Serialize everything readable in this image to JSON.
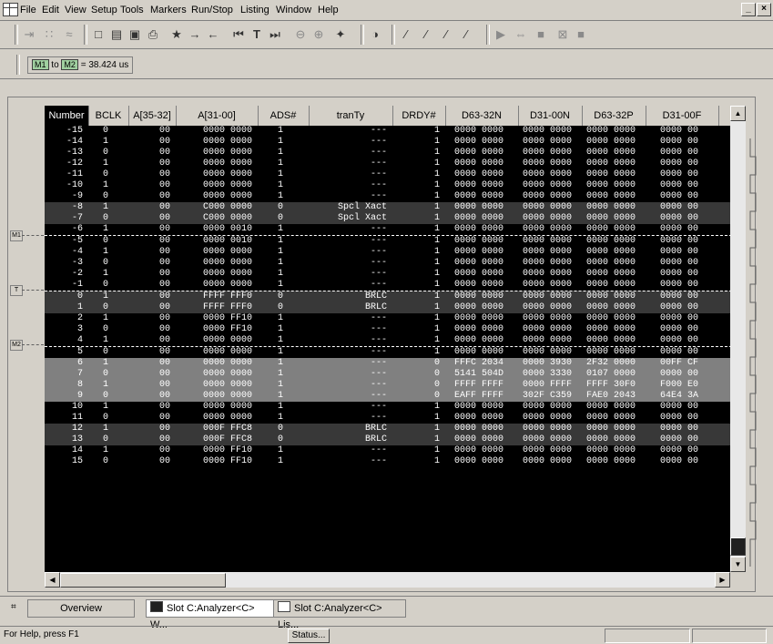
{
  "menu": [
    "File",
    "Edit",
    "View",
    "Setup",
    "Tools",
    "Markers",
    "Run/Stop",
    "Listing",
    "Window",
    "Help"
  ],
  "window_buttons": [
    "_",
    "×"
  ],
  "toolbar_icons": [
    {
      "name": "run-repetitive-icon",
      "glyph": "⇥"
    },
    {
      "name": "step-icon",
      "glyph": "∷"
    },
    {
      "name": "scope-icon",
      "glyph": "≈"
    },
    {
      "name": "new-icon",
      "glyph": "□"
    },
    {
      "name": "open-icon",
      "glyph": "▤"
    },
    {
      "name": "save-icon",
      "glyph": "▣"
    },
    {
      "name": "print-icon",
      "glyph": "⎙"
    },
    {
      "name": "find-icon",
      "glyph": "★"
    },
    {
      "name": "find-next-icon",
      "glyph": "→"
    },
    {
      "name": "find-prev-icon",
      "glyph": "←"
    },
    {
      "name": "go-start-icon",
      "glyph": "⏮"
    },
    {
      "name": "go-trigger-icon",
      "glyph": "T"
    },
    {
      "name": "go-end-icon",
      "glyph": "⏭"
    },
    {
      "name": "zoom-out-icon",
      "glyph": "⊖"
    },
    {
      "name": "zoom-in-icon",
      "glyph": "⊕"
    },
    {
      "name": "marker-icon",
      "glyph": "✦"
    },
    {
      "name": "compare-icon",
      "glyph": "◑"
    },
    {
      "name": "filter1-icon",
      "glyph": "⁄"
    },
    {
      "name": "filter2-icon",
      "glyph": "⁄"
    },
    {
      "name": "filter3-icon",
      "glyph": "⁄"
    },
    {
      "name": "filter4-icon",
      "glyph": "⁄"
    },
    {
      "name": "run-icon",
      "glyph": "▶"
    },
    {
      "name": "run-group-icon",
      "glyph": "⇔"
    },
    {
      "name": "stop-icon",
      "glyph": "■"
    },
    {
      "name": "cancel-icon",
      "glyph": "⊠"
    },
    {
      "name": "stop2-icon",
      "glyph": "■"
    }
  ],
  "marker_readout": {
    "m1": "M1",
    "to": " to ",
    "m2": "M2",
    "value": " = 38.424 us"
  },
  "columns": [
    "Number",
    "BCLK",
    "A[35-32]",
    "A[31-00]",
    "ADS#",
    "tranTy",
    "DRDY#",
    "D63-32N",
    "D31-00N",
    "D63-32P",
    "D31-00F"
  ],
  "rows": [
    {
      "n": "-15",
      "bclk": "0",
      "ah": "00",
      "al": "0000 0000",
      "ads": "1",
      "tt": "---",
      "drdy": "1",
      "d1": "0000 0000",
      "d2": "0000 0000",
      "d3": "0000 0000",
      "d4": "0000 00",
      "style": ""
    },
    {
      "n": "-14",
      "bclk": "1",
      "ah": "00",
      "al": "0000 0000",
      "ads": "1",
      "tt": "---",
      "drdy": "1",
      "d1": "0000 0000",
      "d2": "0000 0000",
      "d3": "0000 0000",
      "d4": "0000 00",
      "style": ""
    },
    {
      "n": "-13",
      "bclk": "0",
      "ah": "00",
      "al": "0000 0000",
      "ads": "1",
      "tt": "---",
      "drdy": "1",
      "d1": "0000 0000",
      "d2": "0000 0000",
      "d3": "0000 0000",
      "d4": "0000 00",
      "style": ""
    },
    {
      "n": "-12",
      "bclk": "1",
      "ah": "00",
      "al": "0000 0000",
      "ads": "1",
      "tt": "---",
      "drdy": "1",
      "d1": "0000 0000",
      "d2": "0000 0000",
      "d3": "0000 0000",
      "d4": "0000 00",
      "style": ""
    },
    {
      "n": "-11",
      "bclk": "0",
      "ah": "00",
      "al": "0000 0000",
      "ads": "1",
      "tt": "---",
      "drdy": "1",
      "d1": "0000 0000",
      "d2": "0000 0000",
      "d3": "0000 0000",
      "d4": "0000 00",
      "style": ""
    },
    {
      "n": "-10",
      "bclk": "1",
      "ah": "00",
      "al": "0000 0000",
      "ads": "1",
      "tt": "---",
      "drdy": "1",
      "d1": "0000 0000",
      "d2": "0000 0000",
      "d3": "0000 0000",
      "d4": "0000 00",
      "style": ""
    },
    {
      "n": "-9",
      "bclk": "0",
      "ah": "00",
      "al": "0000 0000",
      "ads": "1",
      "tt": "---",
      "drdy": "1",
      "d1": "0000 0000",
      "d2": "0000 0000",
      "d3": "0000 0000",
      "d4": "0000 00",
      "style": ""
    },
    {
      "n": "-8",
      "bclk": "1",
      "ah": "00",
      "al": "C000 0000",
      "ads": "0",
      "tt": "Spcl Xact",
      "drdy": "1",
      "d1": "0000 0000",
      "d2": "0000 0000",
      "d3": "0000 0000",
      "d4": "0000 00",
      "style": "dark"
    },
    {
      "n": "-7",
      "bclk": "0",
      "ah": "00",
      "al": "C000 0000",
      "ads": "0",
      "tt": "Spcl Xact",
      "drdy": "1",
      "d1": "0000 0000",
      "d2": "0000 0000",
      "d3": "0000 0000",
      "d4": "0000 00",
      "style": "dark"
    },
    {
      "n": "-6",
      "bclk": "1",
      "ah": "00",
      "al": "0000 0010",
      "ads": "1",
      "tt": "---",
      "drdy": "1",
      "d1": "0000 0000",
      "d2": "0000 0000",
      "d3": "0000 0000",
      "d4": "0000 00",
      "style": ""
    },
    {
      "n": "-5",
      "bclk": "0",
      "ah": "00",
      "al": "0000 0010",
      "ads": "1",
      "tt": "---",
      "drdy": "1",
      "d1": "0000 0000",
      "d2": "0000 0000",
      "d3": "0000 0000",
      "d4": "0000 00",
      "style": "marker"
    },
    {
      "n": "-4",
      "bclk": "1",
      "ah": "00",
      "al": "0000 0000",
      "ads": "1",
      "tt": "---",
      "drdy": "1",
      "d1": "0000 0000",
      "d2": "0000 0000",
      "d3": "0000 0000",
      "d4": "0000 00",
      "style": ""
    },
    {
      "n": "-3",
      "bclk": "0",
      "ah": "00",
      "al": "0000 0000",
      "ads": "1",
      "tt": "---",
      "drdy": "1",
      "d1": "0000 0000",
      "d2": "0000 0000",
      "d3": "0000 0000",
      "d4": "0000 00",
      "style": ""
    },
    {
      "n": "-2",
      "bclk": "1",
      "ah": "00",
      "al": "0000 0000",
      "ads": "1",
      "tt": "---",
      "drdy": "1",
      "d1": "0000 0000",
      "d2": "0000 0000",
      "d3": "0000 0000",
      "d4": "0000 00",
      "style": ""
    },
    {
      "n": "-1",
      "bclk": "0",
      "ah": "00",
      "al": "0000 0000",
      "ads": "1",
      "tt": "---",
      "drdy": "1",
      "d1": "0000 0000",
      "d2": "0000 0000",
      "d3": "0000 0000",
      "d4": "0000 00",
      "style": ""
    },
    {
      "n": "0",
      "bclk": "1",
      "ah": "00",
      "al": "FFFF FFF0",
      "ads": "0",
      "tt": "BRLC",
      "drdy": "1",
      "d1": "0000 0000",
      "d2": "0000 0000",
      "d3": "0000 0000",
      "d4": "0000 00",
      "style": "dark marker"
    },
    {
      "n": "1",
      "bclk": "0",
      "ah": "00",
      "al": "FFFF FFF0",
      "ads": "0",
      "tt": "BRLC",
      "drdy": "1",
      "d1": "0000 0000",
      "d2": "0000 0000",
      "d3": "0000 0000",
      "d4": "0000 00",
      "style": "dark"
    },
    {
      "n": "2",
      "bclk": "1",
      "ah": "00",
      "al": "0000 FF10",
      "ads": "1",
      "tt": "---",
      "drdy": "1",
      "d1": "0000 0000",
      "d2": "0000 0000",
      "d3": "0000 0000",
      "d4": "0000 00",
      "style": ""
    },
    {
      "n": "3",
      "bclk": "0",
      "ah": "00",
      "al": "0000 FF10",
      "ads": "1",
      "tt": "---",
      "drdy": "1",
      "d1": "0000 0000",
      "d2": "0000 0000",
      "d3": "0000 0000",
      "d4": "0000 00",
      "style": ""
    },
    {
      "n": "4",
      "bclk": "1",
      "ah": "00",
      "al": "0000 0000",
      "ads": "1",
      "tt": "---",
      "drdy": "1",
      "d1": "0000 0000",
      "d2": "0000 0000",
      "d3": "0000 0000",
      "d4": "0000 00",
      "style": ""
    },
    {
      "n": "5",
      "bclk": "0",
      "ah": "00",
      "al": "0000 0000",
      "ads": "1",
      "tt": "---",
      "drdy": "1",
      "d1": "0000 0000",
      "d2": "0000 0000",
      "d3": "0000 0000",
      "d4": "0000 00",
      "style": "marker"
    },
    {
      "n": "6",
      "bclk": "1",
      "ah": "00",
      "al": "0000 0000",
      "ads": "1",
      "tt": "---",
      "drdy": "0",
      "d1": "FFFC 2034",
      "d2": "0000 3930",
      "d3": "2F32 0000",
      "d4": "00FF CF",
      "style": "gray"
    },
    {
      "n": "7",
      "bclk": "0",
      "ah": "00",
      "al": "0000 0000",
      "ads": "1",
      "tt": "---",
      "drdy": "0",
      "d1": "5141 504D",
      "d2": "0000 3330",
      "d3": "0107 0000",
      "d4": "0000 00",
      "style": "gray"
    },
    {
      "n": "8",
      "bclk": "1",
      "ah": "00",
      "al": "0000 0000",
      "ads": "1",
      "tt": "---",
      "drdy": "0",
      "d1": "FFFF FFFF",
      "d2": "0000 FFFF",
      "d3": "FFFF 30F0",
      "d4": "F000 E0",
      "style": "gray"
    },
    {
      "n": "9",
      "bclk": "0",
      "ah": "00",
      "al": "0000 0000",
      "ads": "1",
      "tt": "---",
      "drdy": "0",
      "d1": "EAFF FFFF",
      "d2": "302F C359",
      "d3": "FAE0 2043",
      "d4": "64E4 3A",
      "style": "gray"
    },
    {
      "n": "10",
      "bclk": "1",
      "ah": "00",
      "al": "0000 0000",
      "ads": "1",
      "tt": "---",
      "drdy": "1",
      "d1": "0000 0000",
      "d2": "0000 0000",
      "d3": "0000 0000",
      "d4": "0000 00",
      "style": ""
    },
    {
      "n": "11",
      "bclk": "0",
      "ah": "00",
      "al": "0000 0000",
      "ads": "1",
      "tt": "---",
      "drdy": "1",
      "d1": "0000 0000",
      "d2": "0000 0000",
      "d3": "0000 0000",
      "d4": "0000 00",
      "style": ""
    },
    {
      "n": "12",
      "bclk": "1",
      "ah": "00",
      "al": "000F FFC8",
      "ads": "0",
      "tt": "BRLC",
      "drdy": "1",
      "d1": "0000 0000",
      "d2": "0000 0000",
      "d3": "0000 0000",
      "d4": "0000 00",
      "style": "dark"
    },
    {
      "n": "13",
      "bclk": "0",
      "ah": "00",
      "al": "000F FFC8",
      "ads": "0",
      "tt": "BRLC",
      "drdy": "1",
      "d1": "0000 0000",
      "d2": "0000 0000",
      "d3": "0000 0000",
      "d4": "0000 00",
      "style": "dark"
    },
    {
      "n": "14",
      "bclk": "1",
      "ah": "00",
      "al": "0000 FF10",
      "ads": "1",
      "tt": "---",
      "drdy": "1",
      "d1": "0000 0000",
      "d2": "0000 0000",
      "d3": "0000 0000",
      "d4": "0000 00",
      "style": ""
    },
    {
      "n": "15",
      "bclk": "0",
      "ah": "00",
      "al": "0000 FF10",
      "ads": "1",
      "tt": "---",
      "drdy": "1",
      "d1": "0000 0000",
      "d2": "0000 0000",
      "d3": "0000 0000",
      "d4": "0000 00",
      "style": ""
    }
  ],
  "gutter_markers": [
    {
      "label": "M1",
      "row": 10
    },
    {
      "label": "T",
      "row": 15
    },
    {
      "label": "M2",
      "row": 20
    }
  ],
  "tabs": [
    {
      "label": "Overview",
      "icon": "overview-icon"
    },
    {
      "label": "Slot C:Analyzer<C> W...",
      "icon": "waveform-icon"
    },
    {
      "label": "Slot C:Analyzer<C> Lis...",
      "icon": "listing-icon"
    }
  ],
  "status": {
    "help": "For Help, press F1",
    "button": "Status..."
  }
}
